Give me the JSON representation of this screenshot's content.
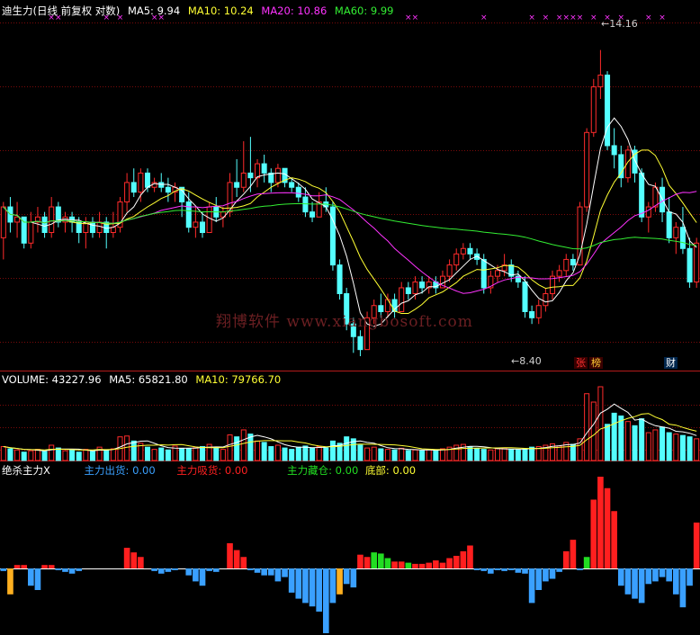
{
  "colors": {
    "up": "#ff2b2b",
    "down": "#54ffff",
    "ma5": "#ffffff",
    "ma10": "#ffff33",
    "ma20": "#ff33ff",
    "ma60": "#33ee33",
    "frame": "#b31a1a",
    "chu": "#3aa0ff",
    "xi": "#ff1f1f",
    "cang": "#22dd22",
    "di": "#ffb020"
  },
  "main_header": {
    "title": "迪生力(日线 前复权 对数)",
    "ma5": "MA5: 9.94",
    "ma10": "MA10: 10.24",
    "ma20": "MA20: 10.86",
    "ma60": "MA60: 9.99"
  },
  "volume_header": {
    "label": "VOLUME: 43227.96",
    "ma5": "MA5: 65821.80",
    "ma10": "MA10: 79766.70"
  },
  "indicator_header": {
    "name": "绝杀主力X",
    "chuhuo": "主力出货: 0.00",
    "xishou": "主力吸货: 0.00",
    "cangcang": "主力藏仓: 0.00",
    "dibu": "底部: 0.00"
  },
  "annotations": {
    "high": "14.16",
    "low": "8.40"
  },
  "watermark": "翔博软件 www.xiangbosoft.com",
  "tags": {
    "zhang": "张",
    "bang": "榜",
    "cai": "财"
  },
  "chart_data": {
    "type": "candlestick",
    "yscale": "log",
    "price_range": [
      7.9,
      15.0
    ],
    "candles": [
      [
        9.9,
        10.6,
        9.5,
        10.5
      ],
      [
        10.5,
        10.7,
        10.0,
        10.2
      ],
      [
        10.2,
        10.6,
        9.9,
        10.3
      ],
      [
        10.3,
        10.3,
        9.7,
        9.8
      ],
      [
        9.8,
        10.4,
        9.7,
        10.2
      ],
      [
        10.2,
        10.5,
        10.0,
        10.3
      ],
      [
        10.3,
        10.4,
        9.9,
        10.0
      ],
      [
        10.0,
        10.7,
        9.9,
        10.5
      ],
      [
        10.5,
        10.6,
        10.1,
        10.2
      ],
      [
        10.2,
        10.4,
        10.0,
        10.3
      ],
      [
        10.3,
        10.4,
        10.0,
        10.2
      ],
      [
        10.2,
        10.3,
        9.8,
        10.0
      ],
      [
        10.0,
        10.3,
        9.7,
        10.2
      ],
      [
        10.2,
        10.3,
        9.9,
        10.0
      ],
      [
        10.0,
        10.4,
        9.9,
        10.2
      ],
      [
        10.2,
        10.3,
        9.7,
        10.0
      ],
      [
        10.0,
        10.4,
        9.9,
        10.1
      ],
      [
        10.1,
        10.7,
        10.0,
        10.6
      ],
      [
        10.6,
        11.2,
        10.4,
        11.0
      ],
      [
        11.0,
        11.3,
        10.7,
        10.8
      ],
      [
        10.8,
        11.3,
        10.6,
        11.2
      ],
      [
        11.2,
        11.3,
        10.8,
        10.9
      ],
      [
        10.9,
        11.1,
        10.8,
        11.0
      ],
      [
        11.0,
        11.2,
        10.8,
        10.9
      ],
      [
        10.9,
        11.1,
        10.6,
        10.8
      ],
      [
        10.8,
        11.0,
        10.6,
        10.9
      ],
      [
        10.9,
        10.9,
        10.3,
        10.6
      ],
      [
        10.6,
        10.8,
        10.0,
        10.1
      ],
      [
        10.1,
        10.5,
        9.9,
        10.2
      ],
      [
        10.2,
        10.4,
        9.9,
        10.0
      ],
      [
        10.0,
        10.6,
        10.0,
        10.5
      ],
      [
        10.5,
        10.7,
        10.2,
        10.3
      ],
      [
        10.3,
        10.5,
        10.1,
        10.4
      ],
      [
        10.4,
        11.2,
        10.3,
        11.0
      ],
      [
        11.0,
        11.5,
        10.7,
        10.9
      ],
      [
        10.9,
        11.9,
        10.8,
        11.2
      ],
      [
        11.2,
        12.0,
        10.8,
        11.1
      ],
      [
        11.1,
        11.5,
        10.9,
        11.4
      ],
      [
        11.4,
        11.6,
        11.0,
        11.2
      ],
      [
        11.2,
        11.3,
        10.8,
        11.0
      ],
      [
        11.0,
        11.4,
        10.9,
        11.3
      ],
      [
        11.3,
        11.3,
        10.9,
        11.0
      ],
      [
        11.0,
        11.1,
        10.8,
        10.9
      ],
      [
        10.9,
        11.0,
        10.6,
        10.7
      ],
      [
        10.7,
        10.9,
        10.3,
        10.4
      ],
      [
        10.4,
        10.6,
        10.2,
        10.3
      ],
      [
        10.3,
        10.8,
        10.3,
        10.6
      ],
      [
        10.6,
        10.9,
        10.4,
        10.5
      ],
      [
        10.5,
        10.6,
        9.3,
        9.4
      ],
      [
        9.4,
        9.5,
        8.8,
        8.9
      ],
      [
        8.9,
        9.0,
        8.3,
        8.4
      ],
      [
        8.4,
        8.5,
        7.95,
        8.2
      ],
      [
        8.2,
        8.3,
        7.9,
        8.0
      ],
      [
        8.0,
        8.6,
        8.0,
        8.5
      ],
      [
        8.5,
        8.8,
        8.4,
        8.7
      ],
      [
        8.7,
        8.9,
        8.5,
        8.6
      ],
      [
        8.6,
        8.9,
        8.5,
        8.8
      ],
      [
        8.8,
        8.9,
        8.5,
        8.6
      ],
      [
        8.6,
        9.1,
        8.6,
        9.0
      ],
      [
        9.0,
        9.1,
        8.8,
        8.9
      ],
      [
        8.9,
        9.2,
        8.8,
        9.1
      ],
      [
        9.1,
        9.2,
        8.9,
        9.0
      ],
      [
        9.0,
        9.2,
        8.9,
        9.1
      ],
      [
        9.1,
        9.2,
        8.9,
        9.0
      ],
      [
        9.0,
        9.3,
        9.0,
        9.2
      ],
      [
        9.2,
        9.5,
        9.1,
        9.4
      ],
      [
        9.4,
        9.7,
        9.3,
        9.6
      ],
      [
        9.6,
        9.8,
        9.5,
        9.7
      ],
      [
        9.7,
        9.8,
        9.5,
        9.6
      ],
      [
        9.6,
        9.7,
        9.4,
        9.5
      ],
      [
        9.5,
        9.6,
        8.9,
        9.0
      ],
      [
        9.0,
        9.3,
        8.9,
        9.2
      ],
      [
        9.2,
        9.4,
        9.1,
        9.3
      ],
      [
        9.3,
        9.6,
        9.2,
        9.4
      ],
      [
        9.4,
        9.5,
        9.1,
        9.2
      ],
      [
        9.2,
        9.3,
        9.0,
        9.1
      ],
      [
        9.1,
        9.2,
        8.5,
        8.6
      ],
      [
        8.6,
        8.7,
        8.4,
        8.5
      ],
      [
        8.5,
        8.8,
        8.4,
        8.7
      ],
      [
        8.7,
        9.0,
        8.6,
        8.9
      ],
      [
        8.9,
        9.3,
        8.8,
        9.2
      ],
      [
        9.2,
        9.4,
        9.1,
        9.3
      ],
      [
        9.3,
        9.6,
        9.2,
        9.5
      ],
      [
        9.5,
        9.6,
        9.3,
        9.4
      ],
      [
        9.4,
        10.6,
        9.4,
        10.5
      ],
      [
        10.5,
        12.2,
        10.4,
        12.1
      ],
      [
        12.1,
        13.4,
        12.0,
        13.2
      ],
      [
        13.2,
        14.16,
        12.9,
        13.5
      ],
      [
        13.5,
        13.6,
        11.7,
        11.8
      ],
      [
        11.8,
        12.2,
        11.3,
        11.6
      ],
      [
        11.6,
        11.8,
        10.9,
        11.1
      ],
      [
        11.1,
        11.8,
        11.0,
        11.7
      ],
      [
        11.7,
        11.8,
        11.0,
        11.2
      ],
      [
        11.2,
        11.3,
        10.2,
        10.3
      ],
      [
        10.3,
        10.6,
        10.0,
        10.5
      ],
      [
        10.5,
        11.0,
        10.4,
        10.9
      ],
      [
        10.9,
        11.1,
        10.2,
        10.4
      ],
      [
        10.4,
        10.7,
        9.8,
        9.9
      ],
      [
        9.9,
        10.2,
        9.6,
        10.1
      ],
      [
        10.1,
        10.5,
        9.6,
        9.7
      ],
      [
        9.7,
        9.9,
        9.0,
        9.1
      ],
      [
        9.1,
        9.9,
        9.0,
        9.8
      ]
    ],
    "ma_periods": [
      5,
      10,
      20,
      60
    ],
    "volume": [
      50,
      42,
      38,
      30,
      35,
      40,
      32,
      55,
      45,
      35,
      38,
      30,
      40,
      32,
      48,
      36,
      42,
      85,
      88,
      70,
      62,
      48,
      40,
      45,
      38,
      52,
      44,
      42,
      46,
      50,
      58,
      48,
      40,
      92,
      85,
      110,
      95,
      70,
      65,
      50,
      55,
      45,
      40,
      48,
      52,
      44,
      50,
      45,
      70,
      62,
      85,
      78,
      55,
      45,
      48,
      42,
      40,
      38,
      44,
      36,
      38,
      35,
      40,
      36,
      42,
      48,
      55,
      58,
      50,
      44,
      40,
      38,
      42,
      45,
      40,
      38,
      42,
      48,
      50,
      55,
      60,
      52,
      65,
      58,
      78,
      240,
      210,
      265,
      130,
      170,
      160,
      140,
      125,
      150,
      100,
      110,
      120,
      100,
      95,
      90,
      85,
      78
    ],
    "indicator": [
      -3,
      -30,
      3,
      3,
      -20,
      -25,
      3,
      3,
      -2,
      -4,
      -6,
      -3,
      0,
      0,
      0,
      0,
      0,
      0,
      18,
      14,
      10,
      0,
      -3,
      -6,
      -4,
      -2,
      0,
      -8,
      -15,
      -20,
      -3,
      -4,
      0,
      22,
      16,
      10,
      -2,
      -5,
      -8,
      -8,
      -15,
      -10,
      -28,
      -35,
      -40,
      -44,
      -50,
      -75,
      -40,
      -30,
      -18,
      -22,
      12,
      10,
      14,
      13,
      9,
      6,
      6,
      5,
      4,
      4,
      5,
      7,
      5,
      9,
      11,
      15,
      20,
      -2,
      -3,
      -6,
      -2,
      -3,
      -2,
      -5,
      -6,
      -40,
      -25,
      -15,
      -12,
      -4,
      15,
      25,
      -2,
      10,
      60,
      80,
      70,
      50,
      -20,
      -30,
      -35,
      -40,
      -18,
      -15,
      -10,
      -15,
      -30,
      -45,
      -20,
      40
    ],
    "indicator_types": [
      "c",
      "d",
      "x",
      "x",
      "c",
      "c",
      "x",
      "x",
      "c",
      "c",
      "c",
      "c",
      "c",
      "c",
      "c",
      "c",
      "c",
      "c",
      "x",
      "x",
      "x",
      "c",
      "c",
      "c",
      "c",
      "c",
      "c",
      "c",
      "c",
      "c",
      "c",
      "c",
      "c",
      "x",
      "x",
      "x",
      "c",
      "c",
      "c",
      "c",
      "c",
      "c",
      "c",
      "c",
      "c",
      "c",
      "c",
      "c",
      "c",
      "d",
      "c",
      "c",
      "x",
      "x",
      "g",
      "g",
      "g",
      "x",
      "x",
      "g",
      "x",
      "x",
      "x",
      "x",
      "x",
      "x",
      "x",
      "x",
      "x",
      "c",
      "c",
      "c",
      "c",
      "c",
      "c",
      "c",
      "c",
      "c",
      "c",
      "c",
      "c",
      "c",
      "x",
      "x",
      "c",
      "g",
      "x",
      "x",
      "x",
      "x",
      "c",
      "c",
      "c",
      "c",
      "c",
      "c",
      "c",
      "c",
      "c",
      "c",
      "c",
      "x"
    ],
    "markers_x": [
      7,
      8,
      15,
      17,
      22,
      23,
      59,
      60,
      70,
      77,
      79,
      81,
      82,
      83,
      84,
      86,
      88,
      90,
      94,
      96
    ]
  }
}
